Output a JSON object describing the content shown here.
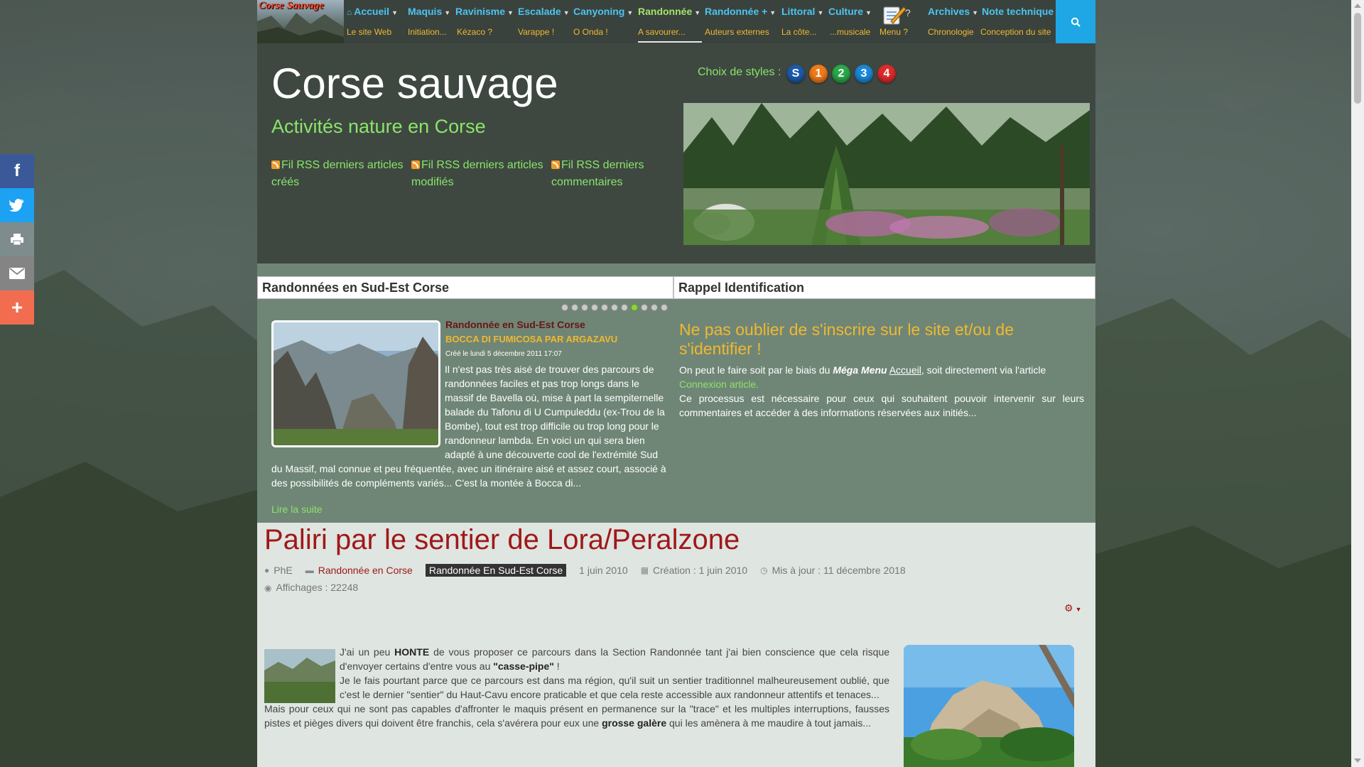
{
  "nav": {
    "logo_text": "Corse Sauvage",
    "items": [
      {
        "label": "Accueil",
        "sub": "Le site Web"
      },
      {
        "label": "Maquis",
        "sub": "Initiation..."
      },
      {
        "label": "Ravinisme",
        "sub": "Kézaco ?"
      },
      {
        "label": "Escalade",
        "sub": "Varappe !"
      },
      {
        "label": "Canyoning",
        "sub": "O Onda !"
      },
      {
        "label": "Randonnée",
        "sub": "A savourer..."
      },
      {
        "label": "Randonnée +",
        "sub": "Auteurs externes"
      },
      {
        "label": "Littoral",
        "sub": "La côte..."
      },
      {
        "label": "Culture",
        "sub": "...musicale"
      },
      {
        "label": "?",
        "sub": "Menu ?"
      },
      {
        "label": "Archives",
        "sub": "Chronologie"
      },
      {
        "label": "Note technique",
        "sub": "Conception du site"
      }
    ]
  },
  "share": {
    "facebook": "f",
    "twitter": "twitter-icon",
    "print": "print-icon",
    "mail": "mail-icon",
    "more": "+"
  },
  "header": {
    "title": "Corse sauvage",
    "subtitle": "Activités nature en Corse",
    "rss": [
      "Fil RSS derniers articles créés",
      "Fil RSS derniers articles modifiés",
      "Fil RSS derniers commentaires"
    ],
    "styles_label": "Choix de styles :",
    "styles": [
      {
        "label": "S",
        "color": "#1e5aa8"
      },
      {
        "label": "1",
        "color": "#f07a1a"
      },
      {
        "label": "2",
        "color": "#2aa84a"
      },
      {
        "label": "3",
        "color": "#1a88d8"
      },
      {
        "label": "4",
        "color": "#e02a2a"
      }
    ]
  },
  "modules": {
    "left_title": "Randonnées en Sud-Est Corse",
    "right_title": "Rappel Identification",
    "slider": {
      "total": 11,
      "active": 7,
      "category": "Randonnée en Sud-Est Corse",
      "title": "BOCCA DI FUMICOSA PAR ARGAZAVU",
      "date": "Créé le lundi 5 décembre 2011 17:07",
      "text": "Il n'est pas très aisé de trouver des parcours de randonnées faciles et pas trop longs dans le massif de Bavella où, mise à part la sempiternelle balade du Tafonu di U Cumpuleddu (ex-Trou de la Bombe), tout est trop difficile ou trop long pour le randonneur lambda. En voici un qui sera bien adapté à une découverte cool de l'extrémité Sud du Massif, mal connue et peu fréquentée, avec un itinéraire aisé et assez court, associé à des possibilités de compléments variés... C'est la montée à Bocca di...",
      "more": "Lire la suite"
    },
    "rappel": {
      "title": "Ne pas oublier de s'inscrire sur le site et/ou de s'identifier !",
      "p1_a": "On peut le faire soit par le biais du",
      "p1_em": "Méga Menu",
      "p1_u": "Accueil",
      "p1_b": ", soit directement via l'article",
      "p1_link": "Connexion article.",
      "p2": "Ce processus est nécessaire pour ceux qui souhaitent pouvoir intervenir sur leurs commentaires et accéder à des informations réservées aux initiés..."
    }
  },
  "article": {
    "title": "Paliri par le sentier de Lora/Peralzone",
    "author": "PhE",
    "category": "Randonnée en Corse",
    "tag": "Randonnée En Sud-Est Corse",
    "published": "1 juin 2010",
    "created": "Création : 1 juin 2010",
    "updated": "Mis à jour : 11 décembre 2018",
    "hits": "Affichages : 22248",
    "p1_a": "J'ai un peu",
    "p1_b1": "HONTE",
    "p1_c": "de vous proposer ce parcours dans la Section Randonnée tant j'ai bien conscience que cela risque d'envoyer certains d'entre vous au",
    "p1_b2": "\"casse-pipe\"",
    "p1_d": "!",
    "p2": "Je le fais pourtant parce que ce parcours est dans ma région, qu'il suit un sentier traditionnel malheureusement oublié, que c'est le dernier \"sentier\" du Haut-Cavu encore praticable et que cela reste accessible aux randonneur attentifs et tenaces...",
    "p3_a": "Mais pour ceux qui ne sont pas capables d'affronter le maquis présent en permanence sur la \"trace\" et les multiples interruptions, fausses pistes et pièges divers qui doivent être franchis, cela s'avérera pour eux une",
    "p3_b": "grosse galère",
    "p3_c": "qui les amènera à me maudire à tout jamais..."
  }
}
